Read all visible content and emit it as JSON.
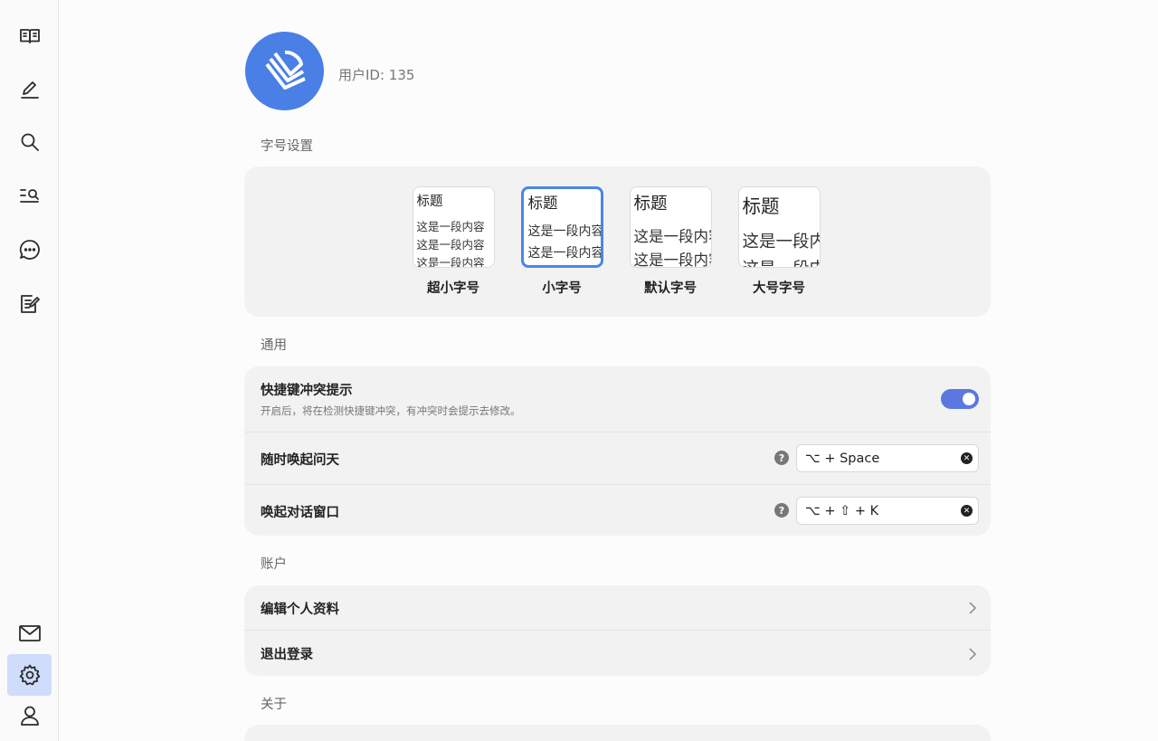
{
  "sidebar": {
    "top_items": [
      {
        "icon": "book-open-icon"
      },
      {
        "icon": "pencil-icon"
      },
      {
        "icon": "search-icon"
      },
      {
        "icon": "list-search-icon"
      },
      {
        "icon": "chat-bubble-icon"
      },
      {
        "icon": "note-edit-icon"
      }
    ],
    "bottom_items": [
      {
        "icon": "mail-icon"
      },
      {
        "icon": "gear-icon",
        "active": true
      },
      {
        "icon": "user-icon"
      }
    ],
    "active_color": "#cfdcfb"
  },
  "profile": {
    "user_id": "用户ID: 135",
    "avatar_color": "#4a7fe6"
  },
  "font_section": {
    "title": "字号设置",
    "preview_title": "标题",
    "preview_body": "这是一段内容",
    "options": [
      {
        "label": "超小字号",
        "selected": false
      },
      {
        "label": "小字号",
        "selected": true
      },
      {
        "label": "默认字号",
        "selected": false
      },
      {
        "label": "大号字号",
        "selected": false
      }
    ]
  },
  "general": {
    "title": "通用",
    "conflict": {
      "title": "快捷键冲突提示",
      "desc": "开启后，将在检测快捷键冲突，有冲突时会提示去修改。",
      "enabled": true
    },
    "wake_anytime": {
      "title": "随时唤起问天",
      "help": "?",
      "shortcut": "⌥ + Space"
    },
    "wake_dialog": {
      "title": "唤起对话窗口",
      "help": "?",
      "shortcut": "⌥ + ⇧ + K"
    },
    "toggle_color": "#5b78de"
  },
  "account": {
    "title": "账户",
    "edit_profile": "编辑个人资料",
    "logout": "退出登录"
  },
  "about": {
    "title": "关于"
  }
}
